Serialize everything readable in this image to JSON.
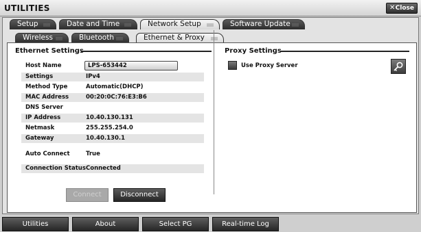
{
  "window": {
    "title": "UTILITIES",
    "close_label": "Close"
  },
  "tabs": [
    "Setup",
    "Date and Time",
    "Network Setup",
    "Software Update"
  ],
  "subtabs": [
    "Wireless",
    "Bluetooth",
    "Ethernet & Proxy"
  ],
  "ethernet": {
    "title": "Ethernet Settings",
    "host_name": {
      "label": "Host Name",
      "value": "LPS-653442"
    },
    "fields": [
      {
        "label": "Settings",
        "value": "IPv4"
      },
      {
        "label": "Method Type",
        "value": "Automatic(DHCP)"
      },
      {
        "label": "MAC Address",
        "value": "00:20:0C:76:E3:B6"
      },
      {
        "label": "DNS Server",
        "value": ""
      },
      {
        "label": "IP Address",
        "value": "10.40.130.131"
      },
      {
        "label": "Netmask",
        "value": "255.255.254.0"
      },
      {
        "label": "Gateway",
        "value": "10.40.130.1"
      },
      {
        "label": "Auto Connect",
        "value": "True"
      },
      {
        "label": "Connection Status",
        "value": "Connected"
      }
    ],
    "connect_label": "Connect",
    "disconnect_label": "Disconnect"
  },
  "proxy": {
    "title": "Proxy Settings",
    "use_proxy_label": "Use Proxy Server",
    "use_proxy_checked": false,
    "key_icon": "key-icon"
  },
  "bottom_nav": [
    "Utilities",
    "About",
    "Select PG",
    "Real-time Log"
  ]
}
